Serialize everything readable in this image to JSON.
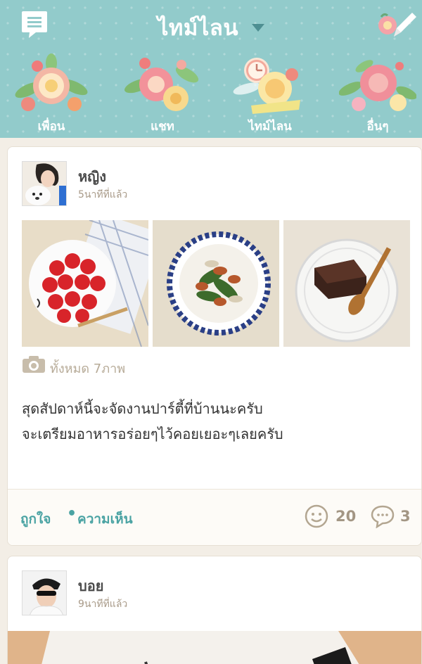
{
  "header": {
    "title": "ไทม์ไลน",
    "menu_icon": "menu-list-icon",
    "compose_icon": "compose-pencil-icon"
  },
  "nav": {
    "items": [
      {
        "label": "เพื่อน",
        "icon": "flower-bouquet-icon"
      },
      {
        "label": "แชท",
        "icon": "flower-bouquet-icon"
      },
      {
        "label": "ไทม์ไลน",
        "icon": "clock-flower-icon",
        "active": true
      },
      {
        "label": "อื่นๆ",
        "icon": "flower-bouquet-icon"
      }
    ]
  },
  "posts": [
    {
      "author": "หญิง",
      "time": "5นาทีที่แล้ว",
      "photo_count": "ทั้งหมด 7ภาพ",
      "photos": [
        "strawberries-photo",
        "salad-photo",
        "chocolate-cake-photo"
      ],
      "text_lines": [
        "สุดสัปดาห์นี้จะจัดงานปาร์ตี้ที่บ้านนะครับ",
        "จะเตรียมอาหารอร่อยๆไว้คอยเยอะๆเลยครับ"
      ],
      "like_label": "ถูกใจ",
      "separator": "•",
      "comment_label": "ความเห็น",
      "like_count": "20",
      "comment_count": "3"
    },
    {
      "author": "บอย",
      "time": "9นาทีที่แล้ว"
    }
  ],
  "colors": {
    "header_bg": "#92cbcb",
    "accent": "#4aa3a3",
    "muted": "#a89a88"
  }
}
